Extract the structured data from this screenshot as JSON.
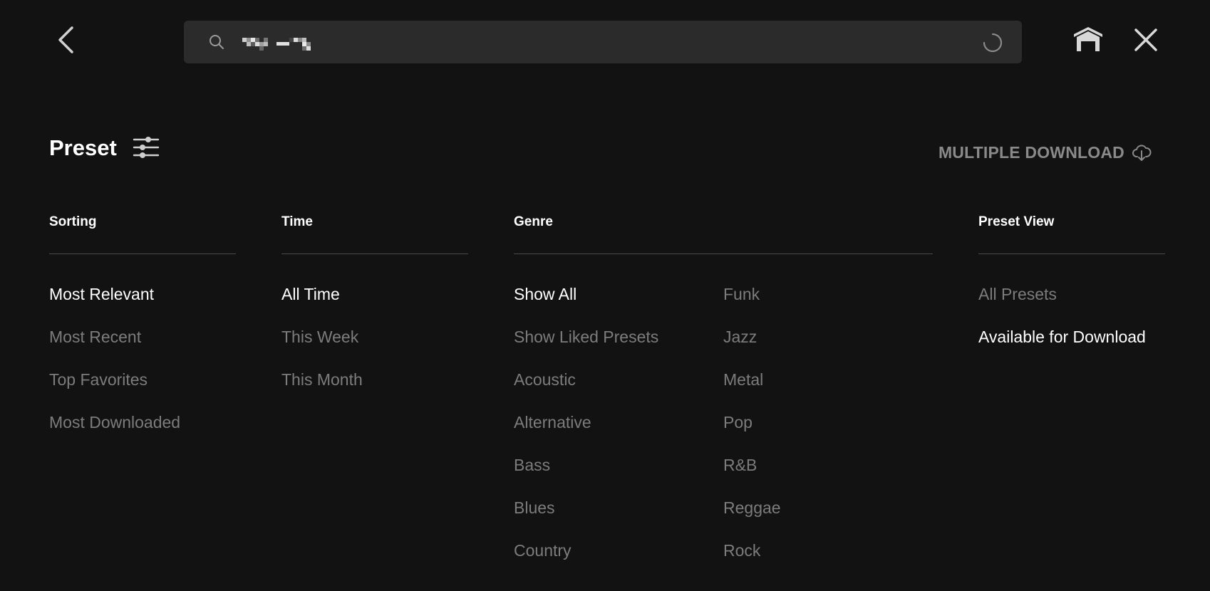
{
  "search": {
    "value": "",
    "placeholder": ""
  },
  "header": {
    "title": "Preset",
    "multiple_download_label": "MULTIPLE DOWNLOAD"
  },
  "filters": {
    "sorting": {
      "heading": "Sorting",
      "options": [
        "Most Relevant",
        "Most Recent",
        "Top Favorites",
        "Most Downloaded"
      ],
      "selected": "Most Relevant"
    },
    "time": {
      "heading": "Time",
      "options": [
        "All Time",
        "This Week",
        "This Month"
      ],
      "selected": "All Time"
    },
    "genre": {
      "heading": "Genre",
      "options_left": [
        "Show All",
        "Show Liked Presets",
        "Acoustic",
        "Alternative",
        "Bass",
        "Blues",
        "Country"
      ],
      "options_right": [
        "Funk",
        "Jazz",
        "Metal",
        "Pop",
        "R&B",
        "Reggae",
        "Rock"
      ],
      "selected": "Show All"
    },
    "preset_view": {
      "heading": "Preset View",
      "options": [
        "All Presets",
        "Available for Download"
      ],
      "selected": "Available for Download"
    }
  },
  "colors": {
    "background": "#121212",
    "search_background": "#2b2b2b",
    "active_text": "#ffffff",
    "inactive_text": "#7c7c7c",
    "muted_label": "#8a8a8a",
    "divider": "#4a4a4a"
  },
  "icons": {
    "back": "chevron-left-icon",
    "search": "search-icon",
    "loading": "spinner-icon",
    "home": "home-icon",
    "close": "close-icon",
    "filter": "sliders-icon",
    "download": "cloud-download-icon"
  }
}
